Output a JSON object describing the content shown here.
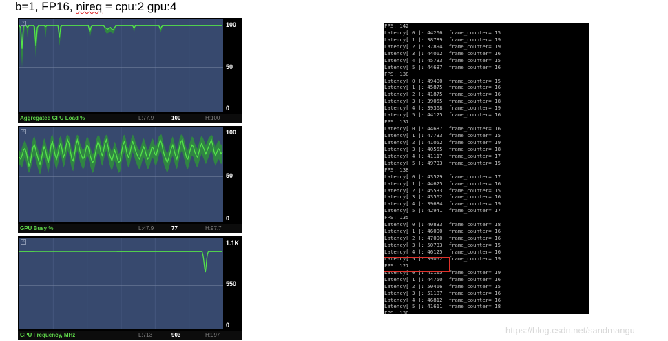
{
  "caption": {
    "prefix": "b=1, FP16, ",
    "underlined": "nireq",
    "suffix": " = cpu:2 gpu:4"
  },
  "monitors": [
    {
      "name": "Aggregated CPU Load %",
      "low": "L:77.9",
      "current": "100",
      "high": "H:100",
      "labels": [
        "100",
        "50",
        "0"
      ],
      "y_max": 100,
      "samples": [
        99,
        97,
        72,
        98,
        99,
        99,
        97,
        99,
        99,
        99,
        99,
        98,
        75,
        97,
        99,
        99,
        99,
        99,
        99,
        98,
        99,
        99,
        99,
        99,
        99,
        99,
        99,
        99,
        99,
        85,
        98,
        99,
        99,
        99,
        99,
        99,
        99,
        99,
        99,
        99,
        99,
        99,
        99,
        99,
        99,
        99,
        99,
        99,
        99,
        99,
        99,
        92,
        98,
        99,
        99,
        99,
        99,
        99,
        99,
        99,
        99,
        99,
        97,
        96,
        95,
        96,
        97,
        95,
        94,
        97,
        99,
        99,
        99,
        99,
        99,
        99,
        99,
        99,
        99,
        99,
        99,
        99,
        99,
        96,
        99,
        99,
        99,
        99,
        99,
        99,
        99,
        99,
        99,
        99,
        99,
        99,
        99,
        99,
        99,
        99,
        99,
        99,
        95,
        98,
        99,
        99,
        99,
        99,
        99,
        99,
        99,
        99,
        99,
        99,
        99,
        99,
        99,
        99,
        99,
        99,
        99,
        99,
        99,
        99,
        99,
        99,
        99,
        99,
        99,
        99,
        99,
        99,
        99,
        99,
        99,
        99,
        99,
        99,
        99,
        99,
        99,
        99,
        99,
        99,
        99,
        99,
        99,
        99
      ],
      "samples_min": [
        99,
        80,
        50,
        80,
        99,
        99,
        85,
        99,
        99,
        99,
        99,
        85,
        60,
        85,
        99,
        99,
        99,
        99,
        99,
        85,
        99,
        99,
        99,
        99,
        99,
        99,
        99,
        99,
        99,
        75,
        88,
        99,
        99,
        99,
        99,
        99,
        99,
        99,
        99,
        99,
        99,
        99,
        99,
        99,
        99,
        99,
        99,
        99,
        99,
        99,
        99,
        84,
        92,
        99,
        99,
        99,
        99,
        99,
        99,
        99,
        99,
        99,
        93,
        90,
        90,
        91,
        92,
        90,
        90,
        93,
        99,
        99,
        99,
        99,
        99,
        99,
        99,
        99,
        99,
        99,
        99,
        99,
        99,
        90,
        99,
        99,
        99,
        99,
        99,
        99,
        99,
        99,
        99,
        99,
        99,
        99,
        99,
        99,
        99,
        99,
        99,
        99,
        90,
        94,
        99,
        99,
        99,
        99,
        99,
        99,
        99,
        99,
        99,
        99,
        99,
        99,
        99,
        99,
        99,
        99,
        99,
        99,
        99,
        99,
        99,
        99,
        99,
        99,
        99,
        99,
        99,
        99,
        99,
        99,
        99,
        99,
        99,
        99,
        99,
        99,
        99,
        99,
        99,
        99,
        99,
        99,
        99,
        99
      ]
    },
    {
      "name": "GPU Busy %",
      "low": "L:47.9",
      "current": "77",
      "high": "H:97.7",
      "labels": [
        "100",
        "50",
        "0"
      ],
      "y_max": 100,
      "samples": [
        72,
        70,
        74,
        80,
        82,
        78,
        70,
        62,
        66,
        76,
        84,
        86,
        80,
        74,
        68,
        64,
        70,
        78,
        84,
        80,
        72,
        66,
        74,
        86,
        90,
        82,
        74,
        70,
        76,
        84,
        88,
        80,
        72,
        76,
        86,
        92,
        88,
        78,
        70,
        68,
        76,
        86,
        92,
        86,
        78,
        74,
        70,
        72,
        80,
        86,
        84,
        76,
        70,
        66,
        68,
        76,
        84,
        90,
        86,
        78,
        74,
        80,
        88,
        92,
        86,
        78,
        72,
        68,
        74,
        80,
        76,
        70,
        66,
        68,
        78,
        86,
        90,
        84,
        76,
        72,
        76,
        84,
        90,
        86,
        80,
        76,
        72,
        70,
        74,
        80,
        84,
        80,
        74,
        70,
        72,
        78,
        84,
        82,
        76,
        74,
        80,
        86,
        92,
        88,
        80,
        74,
        70,
        66,
        70,
        76,
        82,
        86,
        80,
        74,
        70,
        76,
        84,
        90,
        92,
        84,
        78,
        72,
        70,
        76,
        82,
        86,
        84,
        78,
        74,
        72,
        78,
        84,
        88,
        84,
        80,
        76,
        80,
        84,
        88,
        92,
        86,
        78,
        74,
        78,
        82,
        80,
        76,
        78
      ],
      "samples_min": [
        64,
        62,
        60,
        66,
        72,
        66,
        58,
        54,
        58,
        64,
        72,
        74,
        68,
        62,
        56,
        52,
        58,
        66,
        72,
        68,
        60,
        54,
        62,
        72,
        78,
        70,
        62,
        58,
        64,
        72,
        76,
        68,
        60,
        64,
        74,
        80,
        76,
        66,
        58,
        56,
        64,
        74,
        80,
        74,
        66,
        62,
        58,
        60,
        68,
        74,
        72,
        64,
        58,
        54,
        56,
        64,
        72,
        78,
        74,
        66,
        62,
        68,
        76,
        80,
        74,
        66,
        60,
        56,
        62,
        68,
        64,
        58,
        54,
        56,
        66,
        74,
        78,
        72,
        64,
        60,
        64,
        72,
        78,
        74,
        68,
        64,
        60,
        58,
        62,
        68,
        72,
        68,
        62,
        58,
        60,
        66,
        72,
        70,
        64,
        62,
        68,
        74,
        80,
        76,
        68,
        62,
        58,
        54,
        58,
        64,
        70,
        74,
        68,
        62,
        58,
        64,
        72,
        78,
        80,
        72,
        66,
        60,
        58,
        64,
        70,
        74,
        72,
        66,
        62,
        60,
        66,
        72,
        76,
        72,
        68,
        64,
        68,
        72,
        76,
        80,
        74,
        66,
        62,
        66,
        70,
        68,
        64,
        66
      ],
      "samples_max": [
        80,
        78,
        84,
        88,
        92,
        88,
        82,
        72,
        76,
        86,
        94,
        96,
        90,
        84,
        78,
        74,
        80,
        88,
        94,
        90,
        82,
        76,
        84,
        96,
        98,
        92,
        84,
        80,
        86,
        94,
        97,
        90,
        82,
        86,
        96,
        98,
        96,
        88,
        80,
        78,
        86,
        96,
        98,
        96,
        88,
        84,
        80,
        82,
        90,
        96,
        94,
        86,
        80,
        76,
        78,
        86,
        94,
        98,
        96,
        88,
        84,
        90,
        96,
        98,
        96,
        88,
        82,
        78,
        84,
        90,
        86,
        80,
        76,
        78,
        88,
        96,
        98,
        94,
        86,
        82,
        86,
        94,
        98,
        96,
        90,
        86,
        82,
        80,
        84,
        90,
        94,
        90,
        84,
        80,
        82,
        88,
        94,
        92,
        86,
        84,
        90,
        96,
        98,
        98,
        90,
        84,
        80,
        76,
        80,
        86,
        92,
        96,
        90,
        84,
        80,
        86,
        94,
        98,
        98,
        94,
        88,
        82,
        80,
        86,
        92,
        96,
        94,
        88,
        84,
        82,
        88,
        94,
        97,
        94,
        90,
        86,
        90,
        94,
        96,
        98,
        96,
        88,
        84,
        88,
        92,
        90,
        86,
        88
      ]
    },
    {
      "name": "GPU Frequency, MHz",
      "low": "L:713",
      "current": "903",
      "high": "H:997",
      "labels": [
        "1.1K",
        "550",
        "0"
      ],
      "y_max": 1100,
      "samples": [
        990,
        990,
        990,
        990,
        990,
        990,
        990,
        990,
        990,
        990,
        990,
        990,
        990,
        990,
        990,
        990,
        990,
        990,
        990,
        990,
        990,
        990,
        990,
        991,
        991,
        991,
        991,
        991,
        991,
        991,
        991,
        991,
        991,
        991,
        991,
        991,
        991,
        991,
        991,
        991,
        991,
        991,
        991,
        991,
        991,
        991,
        991,
        991,
        991,
        991,
        991,
        991,
        991,
        991,
        991,
        991,
        991,
        991,
        991,
        991,
        991,
        991,
        991,
        991,
        991,
        991,
        991,
        991,
        991,
        991,
        991,
        991,
        991,
        991,
        991,
        991,
        991,
        991,
        991,
        991,
        991,
        991,
        991,
        991,
        991,
        991,
        991,
        991,
        991,
        991,
        991,
        991,
        991,
        991,
        991,
        991,
        991,
        991,
        991,
        991,
        991,
        991,
        991,
        991,
        991,
        991,
        991,
        991,
        991,
        991,
        991,
        991,
        991,
        991,
        991,
        991,
        991,
        991,
        991,
        991,
        991,
        991,
        991,
        991,
        991,
        991,
        991,
        991,
        991,
        991,
        991,
        991,
        991,
        991,
        991,
        991,
        991,
        991,
        991,
        991,
        991,
        991,
        991,
        991,
        990,
        990,
        990,
        990,
        990,
        990,
        990,
        990,
        990,
        990,
        990,
        990,
        990,
        990,
        990,
        990,
        990,
        990,
        990,
        990,
        990,
        990,
        990,
        990,
        990,
        990,
        990,
        990,
        990,
        990,
        990,
        990,
        990,
        990,
        990,
        990,
        990,
        990,
        990,
        990,
        990,
        990,
        990,
        990,
        990,
        990,
        990,
        990,
        990,
        990,
        990,
        990,
        990,
        990,
        990,
        990,
        990,
        990,
        990,
        990,
        990,
        990,
        990,
        990,
        990,
        990,
        990,
        990,
        990,
        990,
        990,
        990,
        990,
        990,
        990,
        990,
        990,
        990,
        990,
        990,
        990,
        990,
        990,
        990,
        990,
        990,
        990,
        990,
        990,
        990,
        990,
        990,
        990,
        990,
        990,
        990,
        990,
        990,
        990,
        990,
        990,
        990,
        990,
        990,
        990,
        990,
        990,
        990,
        990,
        990,
        990,
        990,
        990,
        990,
        990,
        990,
        990,
        990,
        990,
        990,
        990,
        990,
        990,
        990,
        990,
        990,
        960,
        910,
        830,
        760,
        720,
        800,
        900,
        960,
        985,
        990,
        990,
        990,
        990,
        990,
        990,
        990,
        990,
        990,
        990,
        990,
        990,
        990,
        990,
        990,
        990,
        990,
        990,
        990,
        990,
        990
      ]
    }
  ],
  "console": {
    "lines": [
      "FPS: 142",
      "Latency[ 0 ]: 44266  frame_counter= 15",
      "Latency[ 1 ]: 38789  frame_counter= 19",
      "Latency[ 2 ]: 37894  frame_counter= 19",
      "Latency[ 3 ]: 44062  frame_counter= 16",
      "Latency[ 4 ]: 45733  frame_counter= 15",
      "Latency[ 5 ]: 44687  frame_counter= 16",
      "FPS: 138",
      "Latency[ 0 ]: 49400  frame_counter= 15",
      "Latency[ 1 ]: 45875  frame_counter= 16",
      "Latency[ 2 ]: 41875  frame_counter= 16",
      "Latency[ 3 ]: 39055  frame_counter= 18",
      "Latency[ 4 ]: 39368  frame_counter= 19",
      "Latency[ 5 ]: 44125  frame_counter= 16",
      "FPS: 137",
      "Latency[ 0 ]: 44687  frame_counter= 16",
      "Latency[ 1 ]: 47733  frame_counter= 15",
      "Latency[ 2 ]: 41052  frame_counter= 19",
      "Latency[ 3 ]: 40555  frame_counter= 18",
      "Latency[ 4 ]: 41117  frame_counter= 17",
      "Latency[ 5 ]: 49733  frame_counter= 15",
      "FPS: 138",
      "Latency[ 0 ]: 43529  frame_counter= 17",
      "Latency[ 1 ]: 44625  frame_counter= 16",
      "Latency[ 2 ]: 45533  frame_counter= 15",
      "Latency[ 3 ]: 43562  frame_counter= 16",
      "Latency[ 4 ]: 39684  frame_counter= 19",
      "Latency[ 5 ]: 42941  frame_counter= 17",
      "FPS: 135",
      "Latency[ 0 ]: 40833  frame_counter= 18",
      "Latency[ 1 ]: 46000  frame_counter= 16",
      "Latency[ 2 ]: 47000  frame_counter= 16",
      "Latency[ 3 ]: 50733  frame_counter= 15",
      "Latency[ 4 ]: 46125  frame_counter= 16",
      "Latency[ 5 ]: 39052  frame_counter= 19",
      "FPS: 127",
      "Latency[ 0 ]: 41105  frame_counter= 19",
      "Latency[ 1 ]: 44750  frame_counter= 16",
      "Latency[ 2 ]: 50466  frame_counter= 15",
      "Latency[ 3 ]: 51187  frame_counter= 16",
      "Latency[ 4 ]: 46812  frame_counter= 16",
      "Latency[ 5 ]: 41611  frame_counter= 18",
      "FPS: 130"
    ]
  },
  "watermark": "https://blog.csdn.net/sandmangu",
  "colors": {
    "plot_bg": "#37496e",
    "grid": "#7d8aa6",
    "line": "#55e24a",
    "band": "#2f8f3c",
    "footer_text": "#5fd84a",
    "highlight": "#e0312a"
  },
  "icons": {
    "close": "x-icon"
  }
}
